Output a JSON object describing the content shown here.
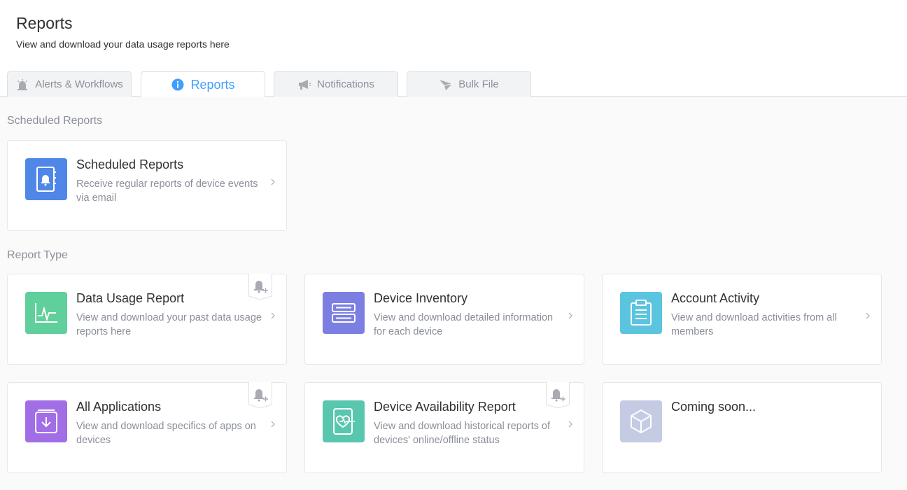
{
  "header": {
    "title": "Reports",
    "subtitle": "View and download your data usage reports here"
  },
  "tabs": [
    {
      "label": "Alerts & Workflows",
      "icon": "alarm-icon",
      "active": false
    },
    {
      "label": "Reports",
      "icon": "info-circle-icon",
      "active": true
    },
    {
      "label": "Notifications",
      "icon": "megaphone-icon",
      "active": false
    },
    {
      "label": "Bulk File",
      "icon": "paper-plane-icon",
      "active": false
    }
  ],
  "sections": {
    "scheduled_label": "Scheduled Reports",
    "report_type_label": "Report Type"
  },
  "cards": {
    "scheduled": {
      "title": "Scheduled Reports",
      "desc": "Receive regular reports of device events via email",
      "icon": "calendar-bell-icon",
      "color": "#4f86e8"
    },
    "data_usage": {
      "title": "Data Usage Report",
      "desc": "View and download your past data usage reports here",
      "icon": "chart-line-icon",
      "color": "#5fcf9b",
      "subscribable": true
    },
    "device_inventory": {
      "title": "Device Inventory",
      "desc": "View and download detailed information for each device",
      "icon": "server-icon",
      "color": "#7b7fe2"
    },
    "account_activity": {
      "title": "Account Activity",
      "desc": "View and download activities from all members",
      "icon": "clipboard-icon",
      "color": "#5bc4df"
    },
    "all_applications": {
      "title": "All Applications",
      "desc": "View and download specifics of apps on devices",
      "icon": "box-download-icon",
      "color": "#a16ee6",
      "subscribable": true
    },
    "device_availability": {
      "title": "Device Availability Report",
      "desc": "View and download historical reports of devices' online/offline status",
      "icon": "tablet-heartbeat-icon",
      "color": "#58c7ad",
      "subscribable": true
    },
    "coming_soon": {
      "title": "Coming soon...",
      "icon": "cube-icon",
      "color": "#c4cbe3"
    }
  }
}
